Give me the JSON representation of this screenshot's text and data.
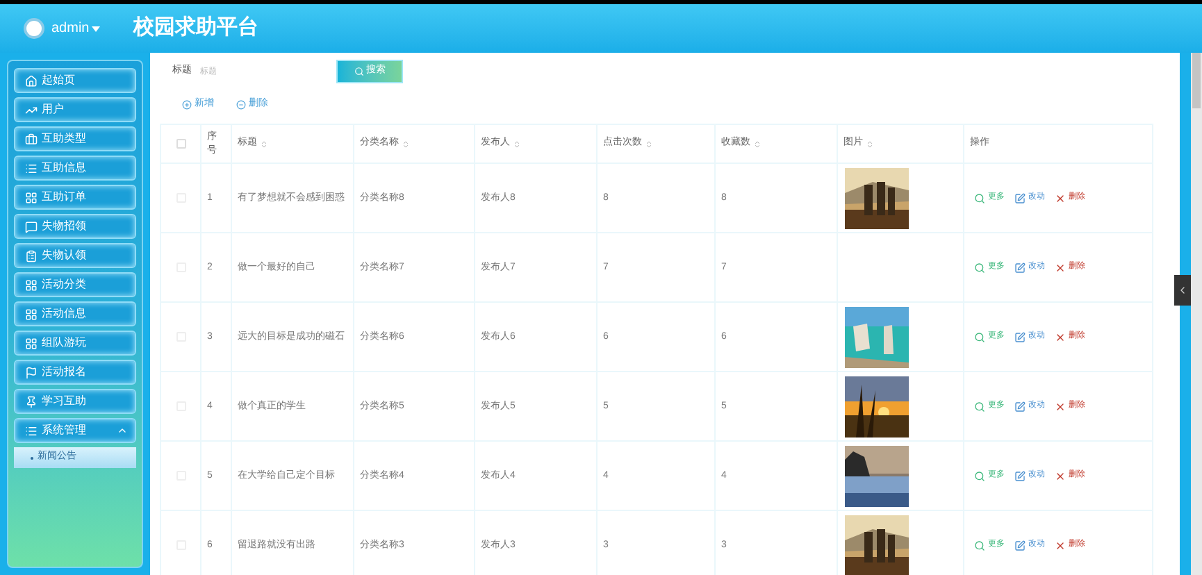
{
  "header": {
    "user": "admin",
    "title": "校园求助平台"
  },
  "sidebar": {
    "items": [
      {
        "label": "起始页",
        "expanded": false
      },
      {
        "label": "用户",
        "expanded": false
      },
      {
        "label": "互助类型",
        "expanded": false
      },
      {
        "label": "互助信息",
        "expanded": false
      },
      {
        "label": "互助订单",
        "expanded": false
      },
      {
        "label": "失物招领",
        "expanded": false
      },
      {
        "label": "失物认领",
        "expanded": false
      },
      {
        "label": "活动分类",
        "expanded": false
      },
      {
        "label": "活动信息",
        "expanded": false
      },
      {
        "label": "组队游玩",
        "expanded": false
      },
      {
        "label": "活动报名",
        "expanded": false
      },
      {
        "label": "学习互助",
        "expanded": false
      },
      {
        "label": "系统管理",
        "expanded": true,
        "children": [
          {
            "label": "新闻公告",
            "selected": true
          }
        ]
      }
    ]
  },
  "search": {
    "label": "标题",
    "placeholder": "标题",
    "button": "搜索"
  },
  "toolbar": [
    "新增",
    "删除"
  ],
  "table": {
    "select_all": {
      "checked": false
    },
    "columns": [
      {
        "label": "序号",
        "sortable": false
      },
      {
        "label": "标题",
        "sortable": true
      },
      {
        "label": "分类名称",
        "sortable": true
      },
      {
        "label": "发布人",
        "sortable": true
      },
      {
        "label": "点击次数",
        "sortable": true
      },
      {
        "label": "收藏数",
        "sortable": true
      },
      {
        "label": "图片",
        "sortable": true
      },
      {
        "label": "操作",
        "sortable": false
      }
    ],
    "rows": [
      {
        "checked": false,
        "cells": [
          "1",
          "有了梦想就不会感到困惑",
          "分类名称8",
          "发布人8",
          "8",
          "8"
        ],
        "picture": true,
        "actions": [
          {
            "label": "更多",
            "kind": "view"
          },
          {
            "label": "改动",
            "kind": "edit"
          },
          {
            "label": "删除",
            "kind": "delete"
          }
        ]
      },
      {
        "checked": false,
        "cells": [
          "2",
          "做一个最好的自己",
          "分类名称7",
          "发布人7",
          "7",
          "7"
        ],
        "picture": false,
        "actions": [
          {
            "label": "更多",
            "kind": "view"
          },
          {
            "label": "改动",
            "kind": "edit"
          },
          {
            "label": "删除",
            "kind": "delete"
          }
        ]
      },
      {
        "checked": false,
        "cells": [
          "3",
          "远大的目标是成功的磁石",
          "分类名称6",
          "发布人6",
          "6",
          "6"
        ],
        "picture": true,
        "actions": [
          {
            "label": "更多",
            "kind": "view"
          },
          {
            "label": "改动",
            "kind": "edit"
          },
          {
            "label": "删除",
            "kind": "delete"
          }
        ]
      },
      {
        "checked": false,
        "cells": [
          "4",
          "做个真正的学生",
          "分类名称5",
          "发布人5",
          "5",
          "5"
        ],
        "picture": true,
        "actions": [
          {
            "label": "更多",
            "kind": "view"
          },
          {
            "label": "改动",
            "kind": "edit"
          },
          {
            "label": "删除",
            "kind": "delete"
          }
        ]
      },
      {
        "checked": false,
        "cells": [
          "5",
          "在大学给自己定个目标",
          "分类名称4",
          "发布人4",
          "4",
          "4"
        ],
        "picture": true,
        "actions": [
          {
            "label": "更多",
            "kind": "view"
          },
          {
            "label": "改动",
            "kind": "edit"
          },
          {
            "label": "删除",
            "kind": "delete"
          }
        ]
      },
      {
        "checked": false,
        "cells": [
          "6",
          "留退路就没有出路",
          "分类名称3",
          "发布人3",
          "3",
          "3"
        ],
        "picture": true,
        "actions": [
          {
            "label": "更多",
            "kind": "view"
          },
          {
            "label": "改动",
            "kind": "edit"
          },
          {
            "label": "删除",
            "kind": "delete"
          }
        ]
      }
    ]
  }
}
